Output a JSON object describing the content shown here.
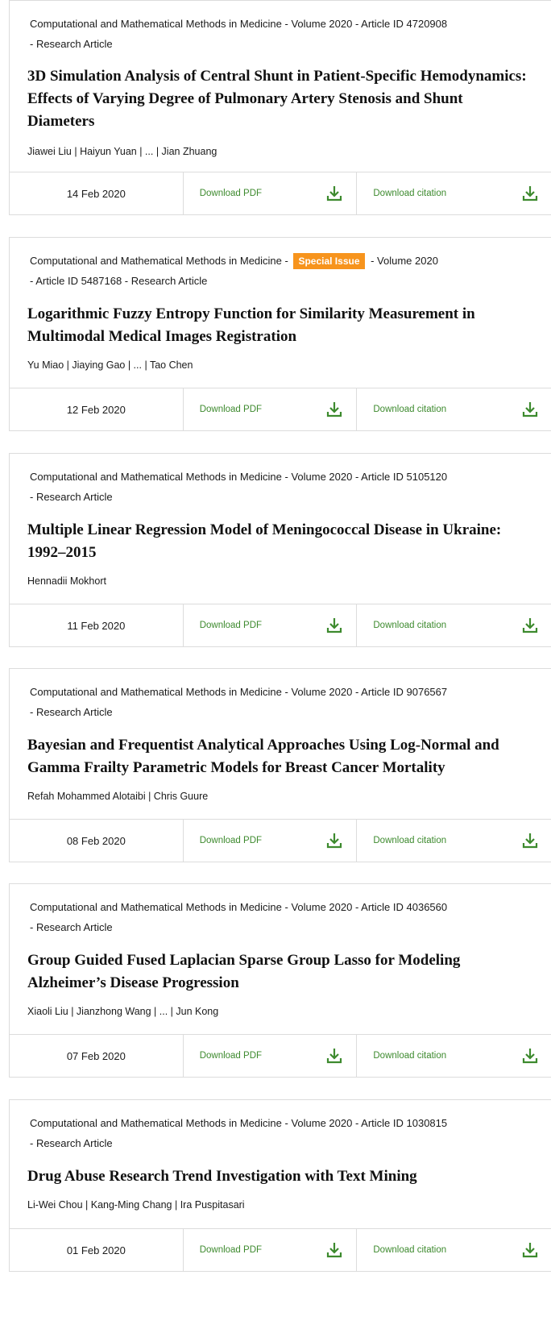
{
  "accent_green": "#3d8a2e",
  "badge_color": "#f7941d",
  "download_icon": "download-arrow-icon",
  "articles": [
    {
      "meta_lines": [
        "Computational and Mathematical Methods in Medicine -  Volume 2020  - Article ID 4720908",
        " - Research Article"
      ],
      "special_issue": null,
      "title": "3D Simulation Analysis of Central Shunt in Patient-Specific Hemodynamics: Effects of Varying Degree of Pulmonary Artery Stenosis and Shunt Diameters",
      "authors": "Jiawei Liu | Haiyun Yuan | ... | Jian Zhuang",
      "date": "14 Feb 2020",
      "download_pdf": "Download PDF",
      "download_citation": "Download citation"
    },
    {
      "meta_lines": [
        "Computational and Mathematical Methods in Medicine - ",
        " - Article ID 5487168  - Research Article"
      ],
      "special_issue": "Special Issue",
      "meta_after_badge": " - Volume 2020",
      "title": "Logarithmic Fuzzy Entropy Function for Similarity Measurement in Multimodal Medical Images Registration",
      "authors": "Yu Miao | Jiaying Gao | ... | Tao Chen",
      "date": "12 Feb 2020",
      "download_pdf": "Download PDF",
      "download_citation": "Download citation"
    },
    {
      "meta_lines": [
        "Computational and Mathematical Methods in Medicine -  Volume 2020  - Article ID 5105120",
        " - Research Article"
      ],
      "special_issue": null,
      "title": "Multiple Linear Regression Model of Meningococcal Disease in Ukraine: 1992–2015",
      "authors": "Hennadii Mokhort",
      "date": "11 Feb 2020",
      "download_pdf": "Download PDF",
      "download_citation": "Download citation"
    },
    {
      "meta_lines": [
        "Computational and Mathematical Methods in Medicine -  Volume 2020  - Article ID 9076567",
        " - Research Article"
      ],
      "special_issue": null,
      "title": "Bayesian and Frequentist Analytical Approaches Using Log-Normal and Gamma Frailty Parametric Models for Breast Cancer Mortality",
      "authors": "Refah Mohammed Alotaibi | Chris Guure",
      "date": "08 Feb 2020",
      "download_pdf": "Download PDF",
      "download_citation": "Download citation"
    },
    {
      "meta_lines": [
        "Computational and Mathematical Methods in Medicine -  Volume 2020  - Article ID 4036560",
        " - Research Article"
      ],
      "special_issue": null,
      "title": "Group Guided Fused Laplacian Sparse Group Lasso for Modeling Alzheimer’s Disease Progression",
      "authors": "Xiaoli Liu | Jianzhong Wang | ... | Jun Kong",
      "date": "07 Feb 2020",
      "download_pdf": "Download PDF",
      "download_citation": "Download citation"
    },
    {
      "meta_lines": [
        "Computational and Mathematical Methods in Medicine -  Volume 2020  - Article ID 1030815",
        " - Research Article"
      ],
      "special_issue": null,
      "title": "Drug Abuse Research Trend Investigation with Text Mining",
      "authors": "Li-Wei Chou | Kang-Ming Chang | Ira Puspitasari",
      "date": "01 Feb 2020",
      "download_pdf": "Download PDF",
      "download_citation": "Download citation"
    }
  ]
}
